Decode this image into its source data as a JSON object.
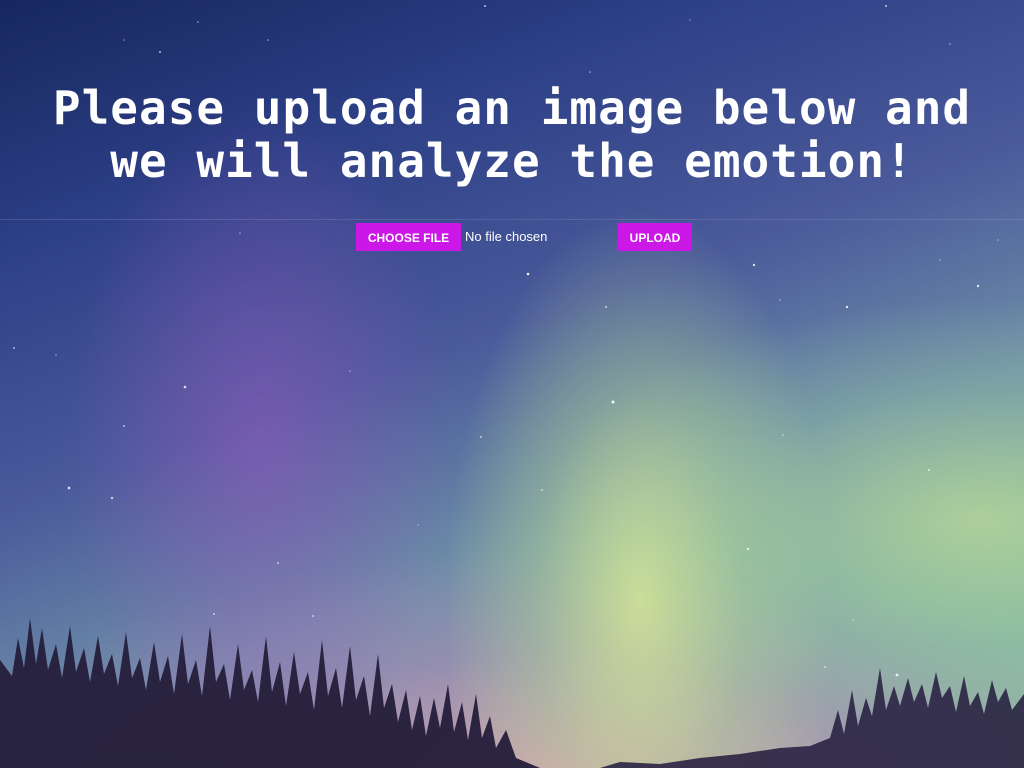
{
  "heading": "Please upload an image below and we will analyze the emotion!",
  "upload_form": {
    "choose_file_label": "Choose File",
    "file_status": "No file chosen",
    "upload_label": "Upload"
  },
  "colors": {
    "button_accent": "#cc18e6",
    "text": "#ffffff"
  }
}
